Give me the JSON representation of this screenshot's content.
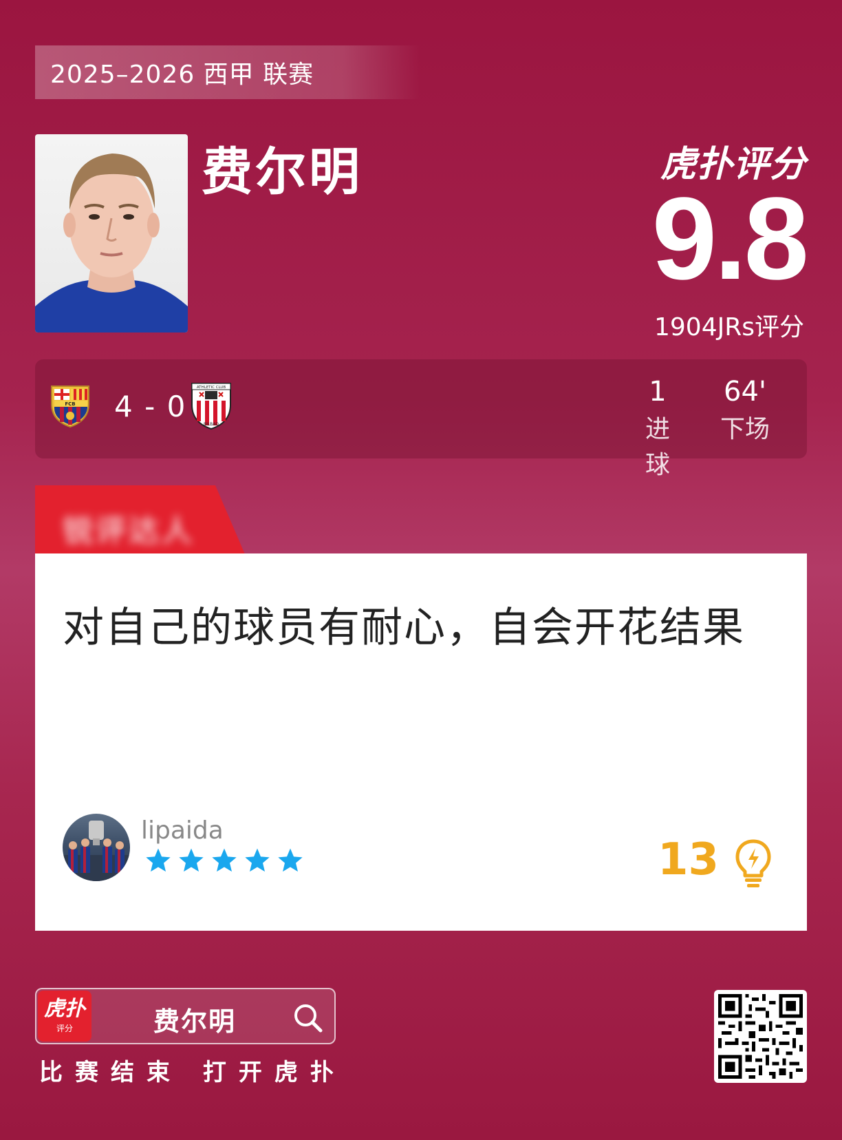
{
  "header": {
    "league": "2025–2026 西甲 联赛"
  },
  "player": {
    "name": "费尔明"
  },
  "brand": {
    "logo_text": "虎扑评分"
  },
  "rating": {
    "score": "9.8",
    "caption": "1904JRs评分"
  },
  "match": {
    "home_team_icon": "fc-barcelona-crest-icon",
    "away_team_icon": "athletic-club-crest-icon",
    "score": "4 - 0",
    "stats": [
      {
        "value": "1",
        "label": "进球"
      },
      {
        "value": "64'",
        "label": "下场"
      }
    ]
  },
  "tag": {
    "text": "锐评达人"
  },
  "comment": {
    "text": "对自己的球员有耐心，自会开花结果",
    "user": "lipaida",
    "stars": 5,
    "likes": "13",
    "colors": {
      "star": "#1aa7ee",
      "likes": "#f0a81e"
    }
  },
  "footer": {
    "app_icon_text": "虎扑",
    "app_icon_sub": "评分",
    "search_label": "费尔明",
    "caption": "比赛结束 打开虎扑"
  },
  "colors": {
    "background": "#a5234e",
    "accent_red": "#e3212e"
  }
}
